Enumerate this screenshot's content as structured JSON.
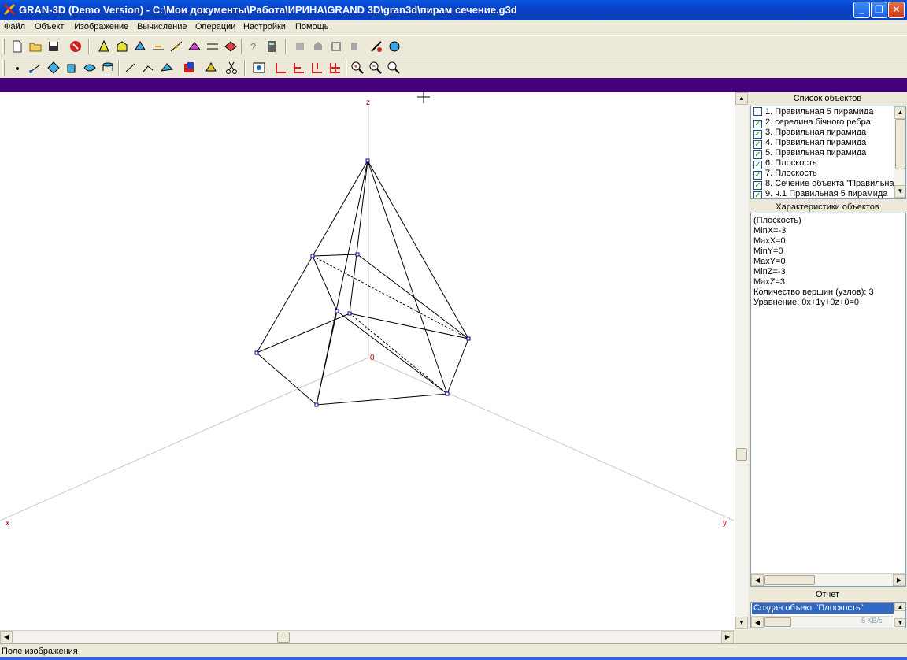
{
  "window": {
    "title": "GRAN-3D (Demo Version) - C:\\Мои документы\\Работа\\ИРИНА\\GRAND 3D\\gran3d\\пирам сечение.g3d",
    "minimize": "_",
    "maximize": "❐",
    "close": "✕"
  },
  "menu": [
    "Файл",
    "Объект",
    "Изображение",
    "Вычисление",
    "Операции",
    "Настройки",
    "Помощь"
  ],
  "canvas": {
    "axis_z": "z",
    "axis_x": "x",
    "axis_y": "y",
    "origin": "0"
  },
  "objects_panel": {
    "title": "Список объектов",
    "items": [
      {
        "label": "1. Правильная 5 пирамида",
        "checked": false
      },
      {
        "label": "2. середина бічного ребра",
        "checked": true
      },
      {
        "label": "3. Правильная пирамида",
        "checked": true
      },
      {
        "label": "4. Правильная пирамида",
        "checked": true
      },
      {
        "label": "5. Правильная пирамида",
        "checked": true
      },
      {
        "label": "6. Плоскость",
        "checked": true
      },
      {
        "label": "7. Плоскость",
        "checked": true
      },
      {
        "label": "8. Сечение объекта \"Правильна",
        "checked": true
      },
      {
        "label": "9. ч.1 Правильная 5 пирамида",
        "checked": true
      }
    ]
  },
  "props_panel": {
    "title": "Характеристики объектов",
    "lines": [
      "(Плоскость)",
      "MinX=-3",
      "MaxX=0",
      "MinY=0",
      "MaxY=0",
      "MinZ=-3",
      "MaxZ=3",
      "Количество вершин (узлов): 3",
      "Уравнение: 0x+1y+0z+0=0"
    ]
  },
  "report_panel": {
    "title": "Отчет",
    "text": "Создан объект \"Плоскость\"",
    "speed": "5 KB/s"
  },
  "status": {
    "text": "Поле изображения"
  },
  "colors": {
    "titlebar": "#0a4fd6",
    "stripe": "#43007a",
    "axis_label": "#c00000",
    "selection": "#316ac5"
  }
}
